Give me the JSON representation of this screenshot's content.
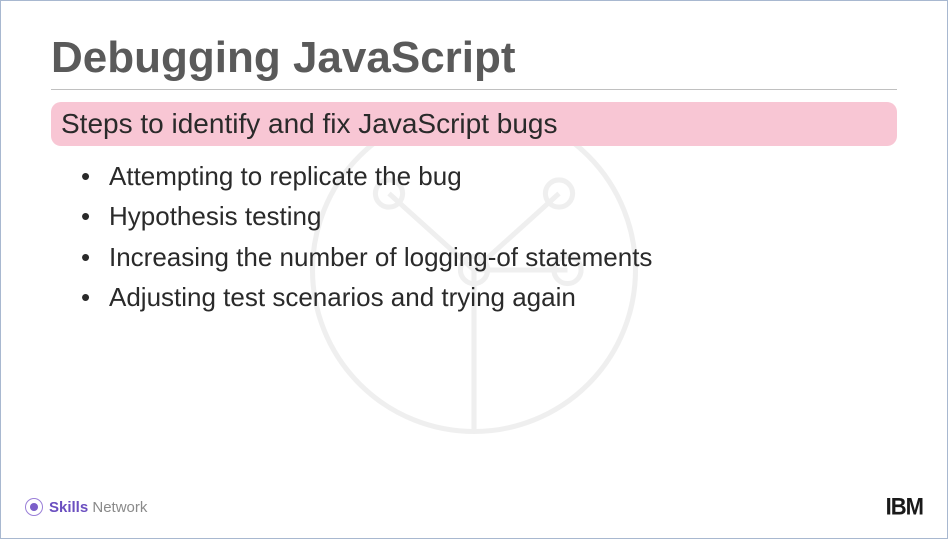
{
  "title": "Debugging JavaScript",
  "subtitle": "Steps to identify and fix JavaScript bugs",
  "bullets": [
    "Attempting to replicate the bug",
    "Hypothesis testing",
    "Increasing the number of logging-of statements",
    "Adjusting test scenarios and trying again"
  ],
  "footer": {
    "skills_bold": "Skills",
    "skills_light": " Network",
    "ibm": "IBM"
  }
}
